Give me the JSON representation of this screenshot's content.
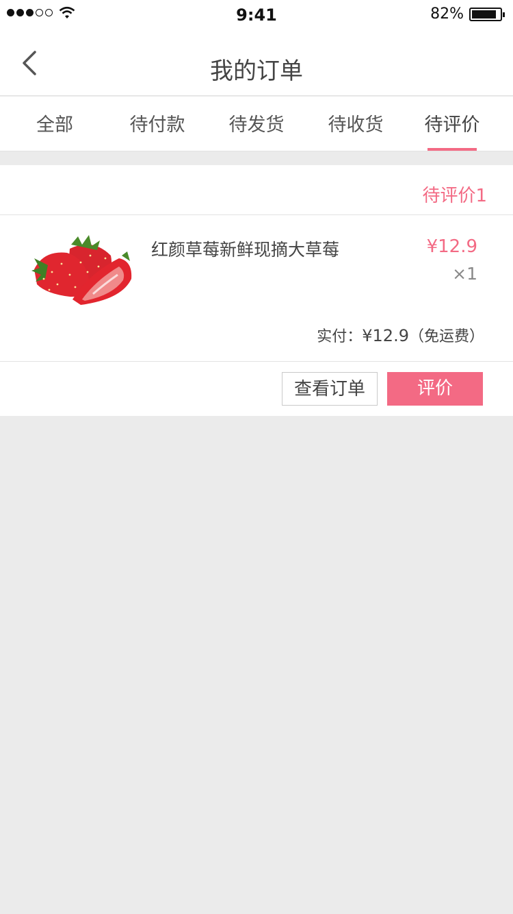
{
  "status_bar": {
    "time": "9:41",
    "battery_percent": "82%",
    "battery_level": 0.82,
    "signal_bars_filled": 3,
    "signal_bars_total": 5
  },
  "nav": {
    "title": "我的订单",
    "back_icon": "chevron-left-icon"
  },
  "tabs": [
    {
      "label": "全部"
    },
    {
      "label": "待付款"
    },
    {
      "label": "待发货"
    },
    {
      "label": "待收货"
    },
    {
      "label": "待评价",
      "active": true
    }
  ],
  "order": {
    "status": "待评价1",
    "product": {
      "name": "红颜草莓新鲜现摘大草莓",
      "price": "¥12.9",
      "quantity": "×1",
      "image": "strawberry-image"
    },
    "total_label": "实付：",
    "total_amount": "¥12.9",
    "shipping_note": "（免运费）",
    "buttons": {
      "view": "查看订单",
      "rate": "评价"
    }
  },
  "colors": {
    "accent": "#f36a84",
    "background": "#ebebeb",
    "text": "#444444"
  }
}
